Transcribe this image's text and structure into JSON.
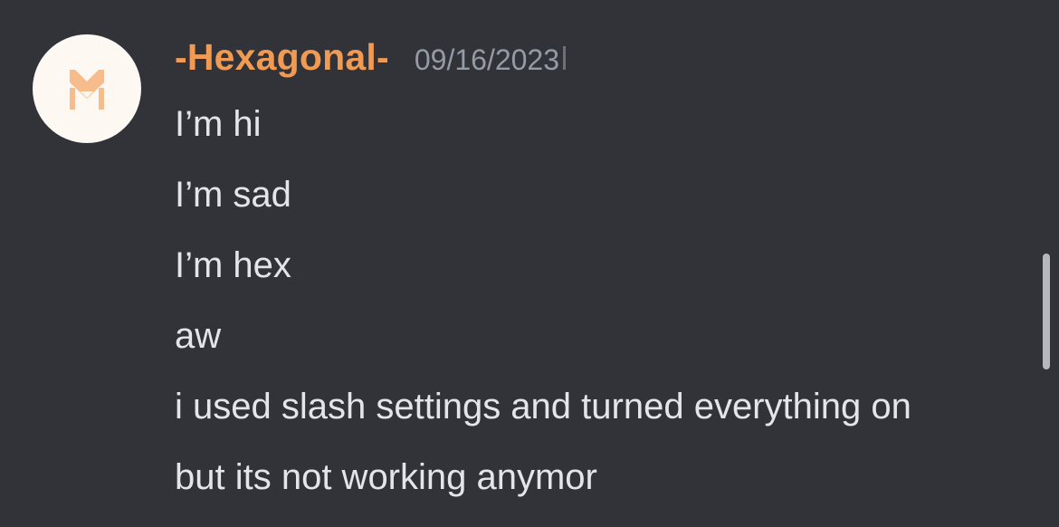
{
  "message": {
    "avatar_icon": "hexagonal-logo-icon",
    "username": "-Hexagonal-",
    "timestamp": "09/16/2023",
    "lines": [
      "I’m hi",
      "I’m sad",
      "I’m hex",
      "aw",
      "i used slash settings and turned everything on",
      "but its not working anymor"
    ]
  },
  "colors": {
    "background": "#313338",
    "username": "#f09a54",
    "timestamp": "#949ba4",
    "text": "#e3e5e8",
    "avatar_bg": "#fdf8f2",
    "avatar_logo": "#f4b27a",
    "scrollbar": "#b5b8bd"
  }
}
